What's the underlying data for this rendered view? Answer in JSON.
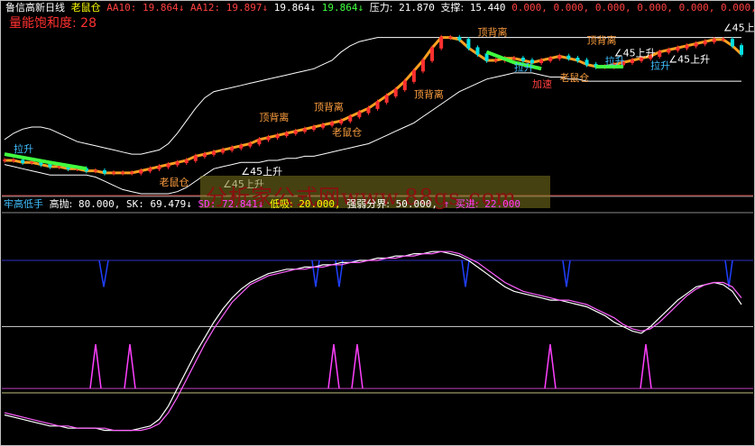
{
  "header": {
    "stock_name": "鲁信高新日线",
    "indicator": "老鼠仓",
    "aa10_label": "AA10:",
    "aa10_value": "19.864",
    "aa12_label": "AA12:",
    "aa12_value": "19.897",
    "value3": "19.864",
    "value4": "19.864",
    "pressure_label": "压力:",
    "pressure_value": "21.870",
    "support_label": "支撑:",
    "support_value": "15.440",
    "zero_values": "0.000, 0.000, 0.000, 0.000, 0.000, 0.000, 0.000,",
    "arrow_down": "↓"
  },
  "subheader": {
    "text": "量能饱和度: 28"
  },
  "watermark": {
    "text": "分析家公式网www.88gs.com"
  },
  "lower_header": {
    "name": "牢高低手",
    "gaopao_label": "高抛:",
    "gaopao_value": "80.000,",
    "sk_label": "SK:",
    "sk_value": "69.479",
    "sd_label": "SD:",
    "sd_value": "72.841",
    "dixi_label": "低吸:",
    "dixi_value": "20.000,",
    "qiangruo_label": "强弱分界:",
    "qiangruo_value": "50.000,",
    "mairu_label": "买进:",
    "mairu_value": "22.000",
    "arrow_up": "↑",
    "arrow_down": "↓"
  },
  "annotations": [
    {
      "text": "顶背离",
      "color": "#ffa040"
    },
    {
      "text": "顶背离",
      "color": "#ffa040"
    },
    {
      "text": "顶背离",
      "color": "#ffa040"
    },
    {
      "text": "顶背离",
      "color": "#ffa040"
    },
    {
      "text": "老鼠仓",
      "color": "#ffa040"
    },
    {
      "text": "老鼠仓",
      "color": "#ffa040"
    },
    {
      "text": "顶背离",
      "color": "#ffa040"
    },
    {
      "text": "老鼠仓",
      "color": "#ffa040"
    },
    {
      "text": "∠45上升",
      "color": "#ffffff"
    },
    {
      "text": "∠45上升",
      "color": "#ffffff"
    },
    {
      "text": "∠45上升",
      "color": "#ffffff"
    },
    {
      "text": "∠45上升",
      "color": "#ffffff"
    },
    {
      "text": "∠45上升",
      "color": "#ffffff"
    },
    {
      "text": "拉升",
      "color": "#40c0ff"
    },
    {
      "text": "拉升",
      "color": "#40c0ff"
    },
    {
      "text": "拉升",
      "color": "#40c0ff"
    },
    {
      "text": "拉升",
      "color": "#40c0ff"
    },
    {
      "text": "加速",
      "color": "#ff4040"
    }
  ],
  "chart_data": [
    {
      "type": "line",
      "name": "price",
      "x": [
        0,
        10,
        20,
        30,
        40,
        50,
        60,
        70,
        80,
        90,
        100,
        110,
        120,
        130,
        140,
        150,
        160,
        170,
        180,
        190,
        200,
        210,
        220,
        230,
        240,
        250,
        260,
        270,
        280,
        290,
        300,
        310,
        320,
        330,
        340,
        350,
        360,
        370,
        380,
        390,
        400,
        410,
        420,
        430,
        440,
        450,
        460,
        470,
        480,
        490,
        500,
        510,
        520,
        530,
        540,
        550,
        560,
        570,
        580,
        590,
        600,
        610,
        620,
        630,
        640,
        650,
        660,
        670,
        680,
        690,
        700,
        710,
        720,
        730,
        740,
        750,
        760,
        770,
        780,
        790,
        800,
        810
      ],
      "series": [
        {
          "name": "upper",
          "values": [
            16.6,
            16.9,
            17.1,
            17.2,
            17.2,
            17.1,
            16.9,
            16.7,
            16.5,
            16.4,
            16.3,
            16.2,
            16.1,
            16.0,
            15.9,
            15.9,
            16.0,
            16.1,
            16.4,
            16.9,
            17.5,
            18.1,
            18.6,
            18.9,
            19.0,
            19.1,
            19.2,
            19.3,
            19.4,
            19.5,
            19.6,
            19.7,
            19.8,
            19.9,
            20.0,
            20.2,
            20.4,
            20.8,
            21.1,
            21.3,
            21.4,
            21.5,
            21.5,
            21.5,
            21.5,
            21.5,
            21.5,
            21.5,
            21.5,
            21.5,
            21.5,
            21.5,
            21.5,
            21.5,
            21.5,
            21.5,
            21.5,
            21.5,
            21.5,
            21.5,
            21.5,
            21.5,
            21.5,
            21.5,
            21.5,
            21.5,
            21.5,
            21.5,
            21.5,
            21.5,
            21.5,
            21.5,
            21.5,
            21.5,
            21.5,
            21.5,
            21.5,
            21.5,
            21.5,
            21.5,
            21.5,
            21.5
          ]
        },
        {
          "name": "lower",
          "values": [
            15.4,
            15.3,
            15.2,
            15.1,
            15.0,
            14.9,
            14.9,
            14.9,
            14.9,
            14.9,
            14.8,
            14.6,
            14.4,
            14.2,
            14.1,
            14.0,
            14.0,
            14.0,
            14.0,
            14.1,
            14.3,
            14.6,
            14.9,
            15.2,
            15.3,
            15.4,
            15.5,
            15.5,
            15.5,
            15.6,
            15.6,
            15.7,
            15.7,
            15.8,
            15.8,
            15.9,
            16.0,
            16.1,
            16.2,
            16.3,
            16.4,
            16.6,
            16.8,
            17.0,
            17.2,
            17.4,
            17.7,
            18.0,
            18.3,
            18.6,
            18.9,
            19.1,
            19.3,
            19.5,
            19.6,
            19.7,
            19.8,
            19.8,
            19.8,
            19.7,
            19.6,
            19.6,
            19.5,
            19.5,
            19.4,
            19.4,
            19.4,
            19.4,
            19.4,
            19.4,
            19.4,
            19.4,
            19.4,
            19.4,
            19.4,
            19.4,
            19.4,
            19.4,
            19.4,
            19.4,
            19.4,
            19.4
          ]
        },
        {
          "name": "close",
          "values": [
            15.6,
            15.6,
            15.5,
            15.5,
            15.4,
            15.3,
            15.3,
            15.2,
            15.2,
            15.1,
            15.1,
            15.0,
            15.0,
            15.0,
            15.0,
            15.1,
            15.2,
            15.3,
            15.4,
            15.5,
            15.6,
            15.8,
            15.9,
            16.0,
            16.1,
            16.2,
            16.3,
            16.4,
            16.6,
            16.7,
            16.8,
            16.9,
            17.0,
            17.1,
            17.2,
            17.3,
            17.4,
            17.5,
            17.7,
            17.9,
            18.1,
            18.4,
            18.7,
            19.0,
            19.4,
            19.9,
            20.4,
            21.0,
            21.5,
            21.5,
            21.4,
            21.0,
            20.7,
            20.4,
            20.4,
            20.5,
            20.5,
            20.4,
            20.3,
            20.4,
            20.5,
            20.6,
            20.5,
            20.4,
            20.2,
            20.1,
            20.1,
            20.2,
            20.3,
            20.4,
            20.5,
            20.6,
            20.8,
            20.9,
            21.0,
            21.1,
            21.2,
            21.3,
            21.4,
            21.4,
            21.1,
            20.7
          ]
        }
      ],
      "ylim": [
        14.0,
        22.0
      ]
    },
    {
      "type": "line",
      "name": "oscillator",
      "x": [
        0,
        10,
        20,
        30,
        40,
        50,
        60,
        70,
        80,
        90,
        100,
        110,
        120,
        130,
        140,
        150,
        160,
        170,
        180,
        190,
        200,
        210,
        220,
        230,
        240,
        250,
        260,
        270,
        280,
        290,
        300,
        310,
        320,
        330,
        340,
        350,
        360,
        370,
        380,
        390,
        400,
        410,
        420,
        430,
        440,
        450,
        460,
        470,
        480,
        490,
        500,
        510,
        520,
        530,
        540,
        550,
        560,
        570,
        580,
        590,
        600,
        610,
        620,
        630,
        640,
        650,
        660,
        670,
        680,
        690,
        700,
        710,
        720,
        730,
        740,
        750,
        760,
        770,
        780,
        790,
        800,
        810
      ],
      "series": [
        {
          "name": "SK",
          "values": [
            10,
            9,
            8,
            7,
            6,
            5,
            5,
            4,
            4,
            4,
            4,
            3,
            3,
            3,
            3,
            4,
            5,
            8,
            14,
            22,
            30,
            38,
            45,
            52,
            58,
            63,
            67,
            70,
            72,
            74,
            75,
            76,
            76,
            77,
            77,
            78,
            78,
            79,
            79,
            80,
            80,
            81,
            81,
            82,
            82,
            83,
            83,
            84,
            84,
            83,
            82,
            80,
            77,
            74,
            71,
            68,
            66,
            65,
            64,
            63,
            62,
            62,
            61,
            60,
            59,
            57,
            55,
            52,
            50,
            48,
            47,
            50,
            54,
            58,
            62,
            65,
            68,
            69,
            70,
            69,
            66,
            60
          ]
        },
        {
          "name": "SD",
          "values": [
            11,
            10,
            9,
            8,
            7,
            6,
            5,
            5,
            4,
            4,
            4,
            4,
            3,
            3,
            3,
            3,
            4,
            6,
            11,
            18,
            26,
            34,
            42,
            49,
            55,
            61,
            65,
            69,
            71,
            73,
            74,
            75,
            76,
            76,
            77,
            77,
            78,
            78,
            79,
            79,
            80,
            80,
            81,
            81,
            82,
            82,
            83,
            83,
            84,
            84,
            83,
            81,
            79,
            76,
            73,
            70,
            68,
            66,
            65,
            64,
            63,
            62,
            62,
            61,
            60,
            58,
            56,
            54,
            51,
            49,
            48,
            49,
            52,
            56,
            60,
            64,
            67,
            69,
            70,
            70,
            68,
            63
          ]
        }
      ],
      "levels": {
        "high_sell": 80.0,
        "low_buy": 20.0,
        "divide": 50.0,
        "buy": 22.0
      },
      "ylim": [
        0,
        100
      ]
    }
  ]
}
